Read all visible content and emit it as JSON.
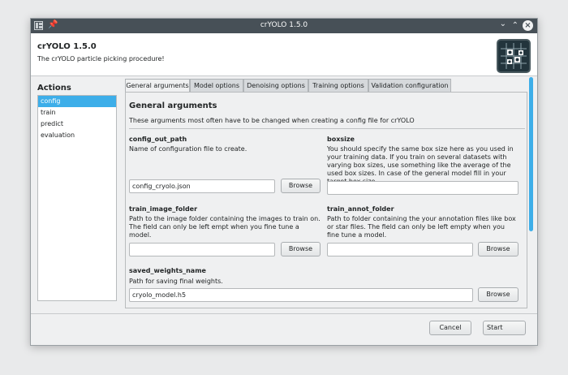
{
  "window": {
    "title": "crYOLO 1.5.0"
  },
  "header": {
    "title": "crYOLO 1.5.0",
    "subtitle": "The crYOLO particle picking procedure!"
  },
  "actions": {
    "title": "Actions",
    "items": [
      "config",
      "train",
      "predict",
      "evaluation"
    ],
    "selected": "config"
  },
  "tabs": [
    "General arguments",
    "Model options",
    "Denoising options",
    "Training options",
    "Validation configuration"
  ],
  "section": {
    "title": "General arguments",
    "description": "These arguments most often have to be changed when creating a config file for crYOLO"
  },
  "fields": {
    "config_out_path": {
      "name": "config_out_path",
      "desc": "Name of configuration file to create.",
      "value": "config_cryolo.json"
    },
    "boxsize": {
      "name": "boxsize",
      "desc": "You should specify the same box size here as you used in your training data.  If you train on several datasets with varying box sizes, use something like the average of the used box sizes. In case of the general model fill in your target box size.",
      "value": ""
    },
    "train_image_folder": {
      "name": "train_image_folder",
      "desc": "Path to the image folder containing the images to train on. The field can only be left empt when you fine tune a model.",
      "value": ""
    },
    "train_annot_folder": {
      "name": "train_annot_folder",
      "desc": "Path to folder containing the your annotation files like box or star files. The field can only be left empty when you fine tune a model.",
      "value": ""
    },
    "saved_weights_name": {
      "name": "saved_weights_name",
      "desc": "Path for saving final weights.",
      "value": "cryolo_model.h5"
    }
  },
  "buttons": {
    "browse": "Browse",
    "cancel": "Cancel",
    "start": "Start"
  },
  "colors": {
    "accent": "#3daee9",
    "titlebar": "#475057"
  }
}
